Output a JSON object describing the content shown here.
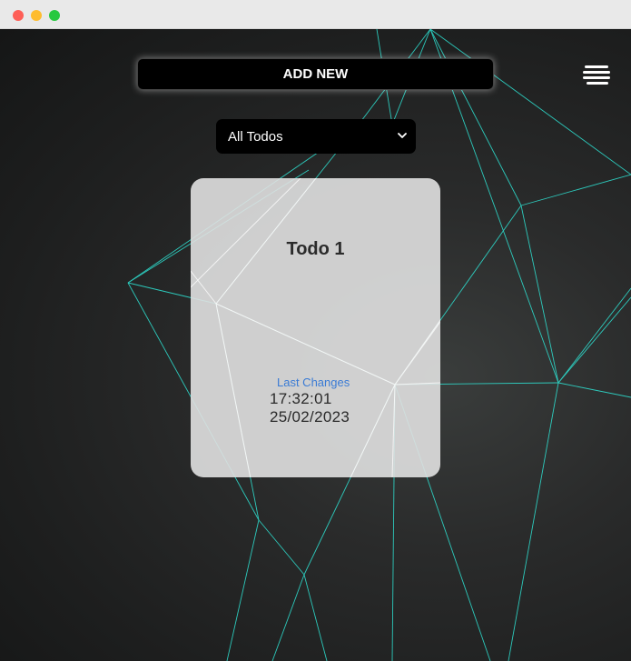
{
  "window": {
    "controls": [
      "close",
      "minimize",
      "maximize"
    ]
  },
  "toolbar": {
    "add_label": "ADD NEW",
    "menu_icon": "hamburger-menu-icon"
  },
  "filter": {
    "selected": "All Todos"
  },
  "todos": [
    {
      "title": "Todo 1",
      "last_changes_label": "Last Changes",
      "time": "17:32:01",
      "date": "25/02/2023"
    }
  ],
  "colors": {
    "background": "#1e1e1e",
    "network_lines": "#2ee6d6",
    "button_bg": "#000000",
    "card_bg": "#e1e1e1",
    "label_accent": "#3a7bd5"
  }
}
